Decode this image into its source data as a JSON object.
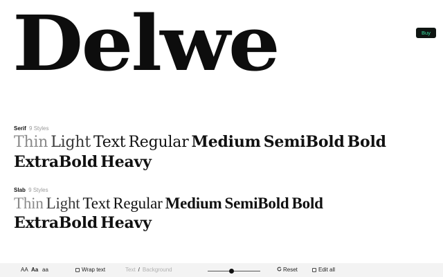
{
  "hero": {
    "title": "Delwe"
  },
  "buy": {
    "label": "Buy"
  },
  "families": [
    {
      "name": "Serif",
      "count": "9 Styles",
      "styles": [
        "Thin",
        "Light",
        "Text",
        "Regular",
        "Medium",
        "SemiBold",
        "Bold",
        "ExtraBold",
        "Heavy"
      ]
    },
    {
      "name": "Slab",
      "count": "9 Styles",
      "styles": [
        "Thin",
        "Light",
        "Text",
        "Regular",
        "Medium",
        "SemiBold",
        "Bold",
        "ExtraBold",
        "Heavy"
      ]
    }
  ],
  "toolbar": {
    "case_upper": "AA",
    "case_title": "Aa",
    "case_lower": "aa",
    "wrap_text": "Wrap text",
    "text_color": "Text",
    "background_color": "Background",
    "size_fraction": 0.45,
    "reset": "Reset",
    "edit_all": "Edit all"
  },
  "icons": {
    "reset": "reset-icon",
    "wrap_checkbox": "checkbox-icon",
    "edit_checkbox": "checkbox-icon"
  },
  "colors": {
    "buy_bg": "#0f1512",
    "buy_text": "#37e0a4",
    "toolbar_bg": "#f3f3f3"
  }
}
